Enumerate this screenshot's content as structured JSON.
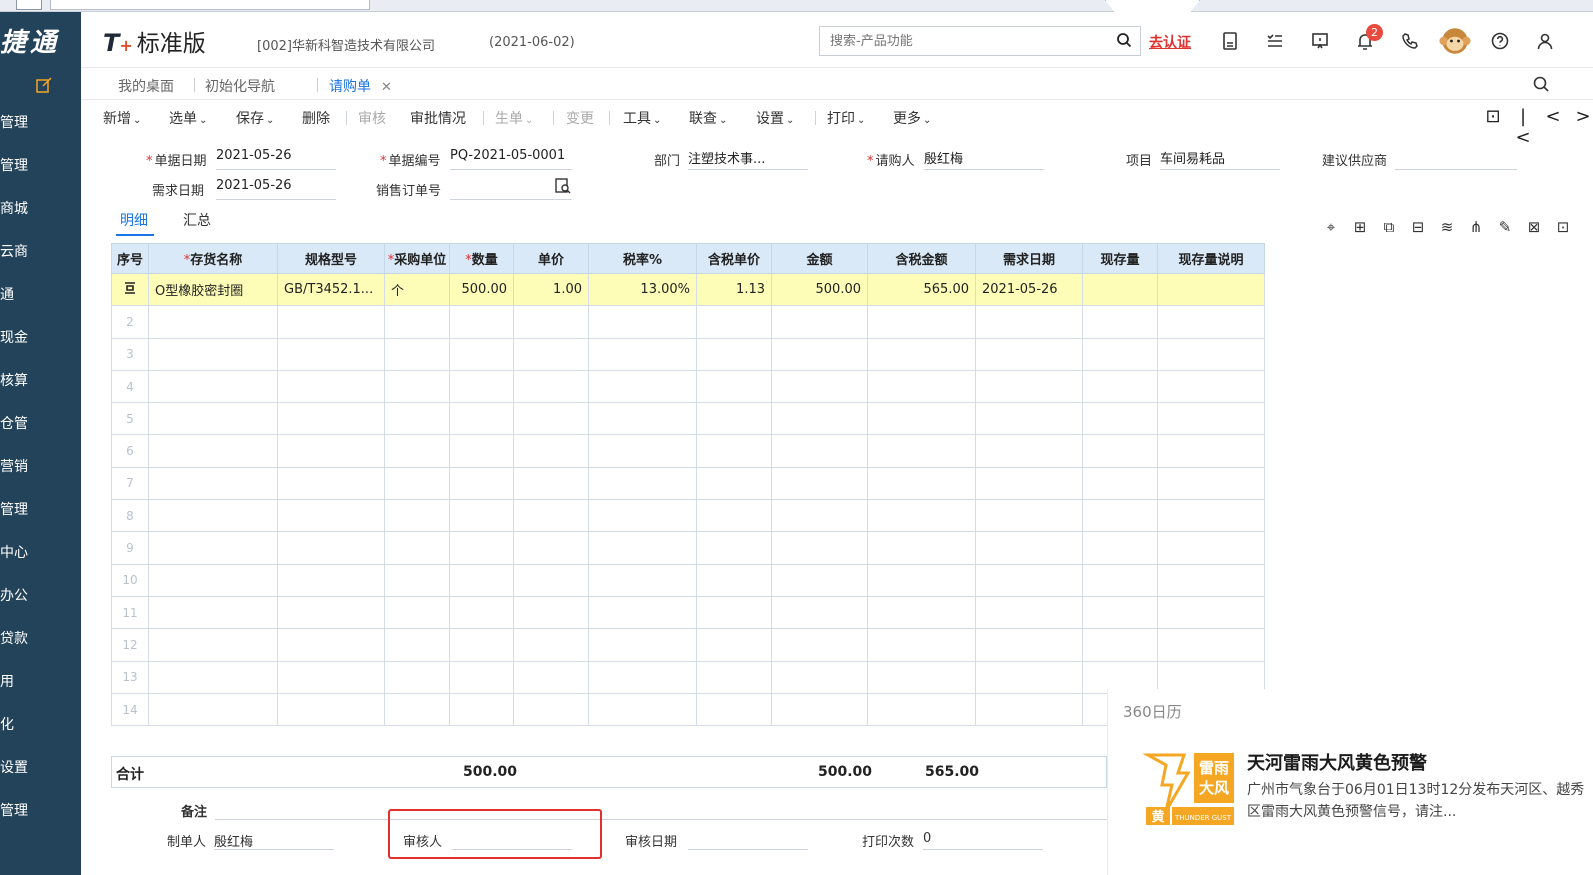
{
  "sidebar": {
    "brand": "捷通",
    "items": [
      "管理",
      "管理",
      "商城",
      "云商",
      "通",
      "现金",
      "核算",
      "仓管",
      "营销",
      "管理",
      "中心",
      "办公",
      "贷款",
      "用",
      "化",
      "设置",
      "管理"
    ]
  },
  "header": {
    "logo_t": "T",
    "logo_plus": "+",
    "logo_name": "标准版",
    "company": "[002]华新科智造技术有限公司",
    "date": "(2021-06-02)",
    "search_placeholder": "搜索-产品功能",
    "certify": "去认证",
    "notification_count": "2",
    "icons": [
      "calculator-icon",
      "task-list-icon",
      "message-icon",
      "bell-icon",
      "phone-icon",
      "monkey-avatar-icon",
      "help-icon",
      "user-icon"
    ]
  },
  "tabs": [
    {
      "label": "我的桌面"
    },
    {
      "label": "初始化导航"
    },
    {
      "label": "请购单",
      "close": "✕"
    }
  ],
  "toolbar": {
    "items": [
      {
        "label": "新增",
        "caret": "⌄"
      },
      {
        "label": "选单",
        "caret": "⌄"
      },
      {
        "label": "保存",
        "caret": "⌄"
      },
      {
        "label": "删除"
      },
      {
        "label": "审核"
      },
      {
        "label": "审批情况"
      },
      {
        "label": "生单",
        "caret": "⌄"
      },
      {
        "label": "变更"
      },
      {
        "label": "工具",
        "caret": "⌄"
      },
      {
        "label": "联查",
        "caret": "⌄"
      },
      {
        "label": "设置",
        "caret": "⌄"
      },
      {
        "label": "打印",
        "caret": "⌄"
      },
      {
        "label": "更多",
        "caret": "⌄"
      }
    ],
    "nav": [
      "⊡",
      "|<",
      "<",
      ">"
    ]
  },
  "form": {
    "doc_date_label": "单据日期",
    "doc_date": "2021-05-26",
    "doc_no_label": "单据编号",
    "doc_no": "PQ-2021-05-0001",
    "dept_label": "部门",
    "dept": "注塑技术事...",
    "requester_label": "请购人",
    "requester": "殷红梅",
    "project_label": "项目",
    "project": "车间易耗品",
    "supplier_label": "建议供应商",
    "supplier": "",
    "need_date_label": "需求日期",
    "need_date": "2021-05-26",
    "sales_order_label": "销售订单号",
    "sales_order": ""
  },
  "subtabs": [
    "明细",
    "汇总"
  ],
  "grid": {
    "columns": [
      "序号",
      "存货名称",
      "规格型号",
      "采购单位",
      "数量",
      "单价",
      "税率%",
      "含税单价",
      "金额",
      "含税金额",
      "需求日期",
      "现存量",
      "现存量说明"
    ],
    "required_columns": [
      "存货名称",
      "采购单位",
      "数量"
    ],
    "rows": [
      [
        "",
        "O型橡胶密封圈",
        "GB/T3452.1...",
        "个",
        "500.00",
        "1.00",
        "13.00%",
        "1.13",
        "500.00",
        "565.00",
        "2021-05-26",
        "",
        ""
      ]
    ],
    "empty_row_numbers": [
      "2",
      "3",
      "4",
      "5",
      "6",
      "7",
      "8",
      "9",
      "10",
      "11",
      "12",
      "13",
      "14"
    ]
  },
  "totals": {
    "label": "合计",
    "quantity": "500.00",
    "amount": "500.00",
    "amount_tax": "565.00"
  },
  "footer": {
    "remark_label": "备注",
    "maker_label": "制单人",
    "maker": "殷红梅",
    "auditor_label": "审核人",
    "auditor": "",
    "audit_date_label": "审核日期",
    "audit_date": "",
    "print_count_label": "打印次数",
    "print_count": "0"
  },
  "notification": {
    "app": "360日历",
    "icon_top": "雷雨",
    "icon_mid": "大风",
    "icon_level": "黄",
    "icon_en": "THUNDER GUST",
    "title": "天河雷雨大风黄色预警",
    "body": "广州市气象台于06月01日13时12分发布天河区、越秀区雷雨大风黄色预警信号，请注..."
  },
  "colors": {
    "sidebar": "#23435a",
    "accent": "#1a73e8",
    "required": "#e0312f",
    "header_row": "#d9e9f7",
    "selected_row": "#fdfdb8",
    "warning_icon": "#f5a623"
  }
}
